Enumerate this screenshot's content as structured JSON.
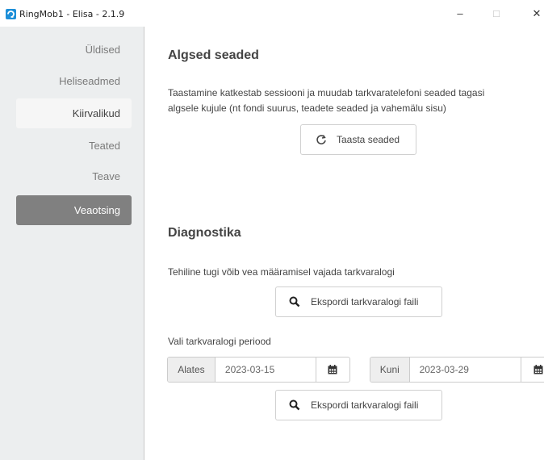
{
  "window": {
    "title": "RingMob1 - Elisa - 2.1.9",
    "minimize_glyph": "–",
    "maximize_glyph": "□",
    "close_glyph": "✕"
  },
  "sidebar": {
    "items": [
      {
        "label": "Üldised"
      },
      {
        "label": "Heliseadmed"
      },
      {
        "label": "Kiirvalikud"
      },
      {
        "label": "Teated"
      },
      {
        "label": "Teave"
      },
      {
        "label": "Veaotsing"
      }
    ],
    "active_index": 5,
    "hover_index": 2
  },
  "reset": {
    "heading": "Algsed seaded",
    "description_line1": "Taastamine katkestab sessiooni ja muudab tarkvaratelefoni seaded tagasi",
    "description_line2": "algsele kujule (nt fondi suurus, teadete seaded ja vahemälu sisu)",
    "button_label": "Taasta seaded"
  },
  "diagnostics": {
    "heading": "Diagnostika",
    "description": "Tehiline tugi võib vea määramisel vajada tarkvaralogi",
    "export_button_label": "Ekspordi tarkvaralogi faili",
    "period_label": "Vali tarkvaralogi periood",
    "from_label": "Alates",
    "from_value": "2023-03-15",
    "to_label": "Kuni",
    "to_value": "2023-03-29",
    "export_period_button_label": "Ekspordi tarkvaralogi faili"
  },
  "colors": {
    "active_nav_bg": "#808080",
    "sidebar_bg": "#eceeef",
    "logo_blue": "#1e8fd8"
  }
}
